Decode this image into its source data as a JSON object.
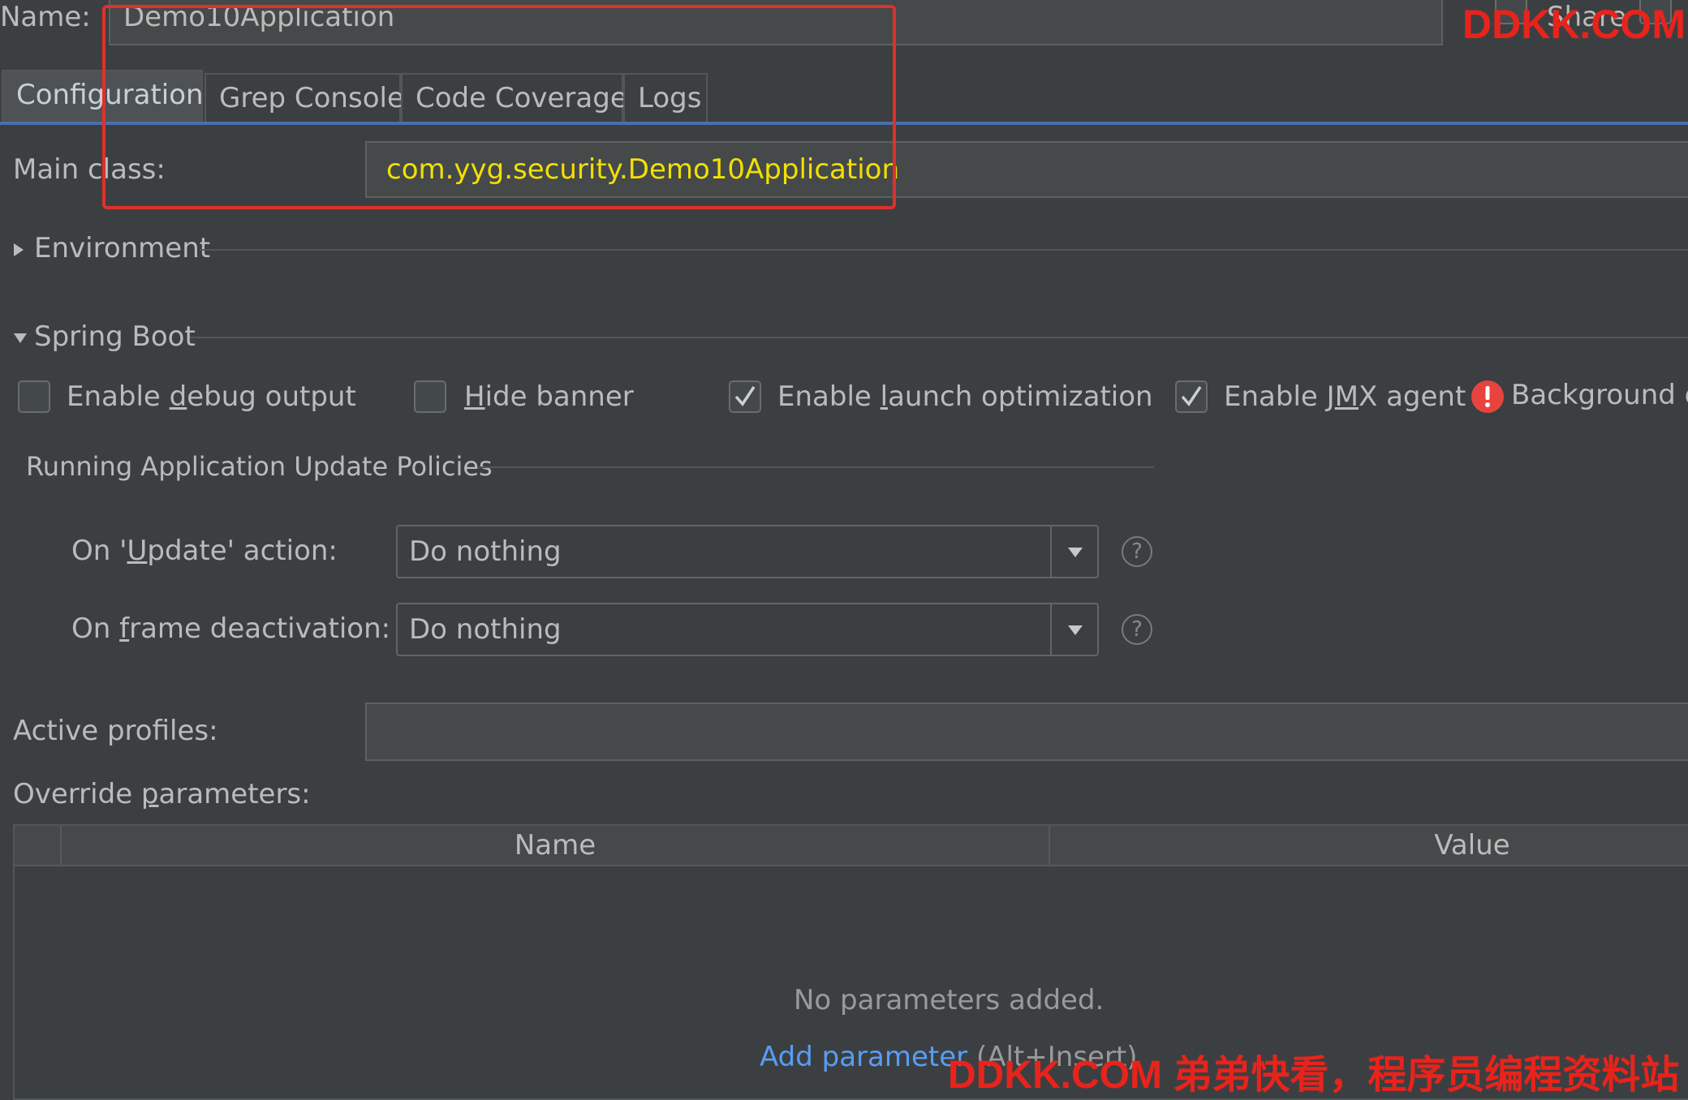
{
  "name_row": {
    "label": "Name:",
    "value": "Demo10Application",
    "share_label": "Share"
  },
  "tabs": [
    {
      "label": "Configuration",
      "active": true
    },
    {
      "label": "Grep Console",
      "active": false
    },
    {
      "label": "Code Coverage",
      "active": false
    },
    {
      "label": "Logs",
      "active": false
    }
  ],
  "main_class": {
    "label": "Main class:",
    "value": "com.yyg.security.Demo10Application"
  },
  "sections": {
    "environment": "Environment",
    "spring_boot": "Spring Boot"
  },
  "checkboxes": [
    {
      "label": "Enable debug output",
      "checked": false
    },
    {
      "label": "Hide banner",
      "checked": false
    },
    {
      "label": "Enable launch optimization",
      "checked": true
    },
    {
      "label": "Enable JMX agent",
      "checked": true
    }
  ],
  "warning_text": "Background c",
  "policies": {
    "title": "Running Application Update Policies",
    "update_label": "On 'Update' action:",
    "update_value": "Do nothing",
    "frame_label": "On frame deactivation:",
    "frame_value": "Do nothing"
  },
  "active_profiles": {
    "label": "Active profiles:",
    "value": ""
  },
  "override": {
    "label": "Override parameters:",
    "columns": [
      "Name",
      "Value"
    ],
    "empty_text": "No parameters added.",
    "add_link": "Add parameter",
    "add_shortcut": "(Alt+Insert)"
  },
  "watermark": {
    "top": "DDKK.COM",
    "bottom": "DDKK.COM 弟弟快看，程序员编程资料站"
  },
  "colors": {
    "background": "#3c3f41",
    "highlight_box": "#e0302a",
    "main_class_text": "#f2e000",
    "link": "#589df6",
    "warning": "#e8443f"
  }
}
